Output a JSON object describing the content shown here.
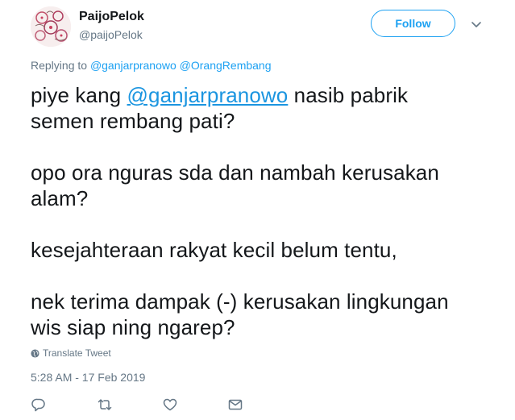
{
  "user": {
    "display_name": "PaijoPelok",
    "handle": "@paijoPelok",
    "follow_label": "Follow"
  },
  "replying": {
    "prefix": "Replying to",
    "mentions": [
      "@ganjarpranowo",
      "@OrangRembang"
    ]
  },
  "tweet": {
    "line1_prefix": "piye kang ",
    "line1_mention": "@ganjarpranowo",
    "line1_suffix": " nasib pabrik",
    "line2": "semen rembang pati?",
    "line3": "opo ora nguras sda dan nambah kerusakan",
    "line4": "alam?",
    "line5": "kesejahteraan rakyat kecil belum tentu,",
    "line6": "nek terima dampak (-) kerusakan lingkungan",
    "line7": "wis siap ning ngarep?"
  },
  "translate_label": "Translate Tweet",
  "timestamp": "5:28 AM - 17 Feb 2019",
  "icons": {
    "reply": "reply-icon",
    "retweet": "retweet-icon",
    "like": "heart-icon",
    "message": "envelope-icon",
    "caret": "chevron-down-icon",
    "globe": "globe-icon"
  },
  "colors": {
    "accent": "#1da1f2",
    "link": "#1b95e0",
    "secondary_text": "#657786",
    "primary_text": "#14171a"
  }
}
